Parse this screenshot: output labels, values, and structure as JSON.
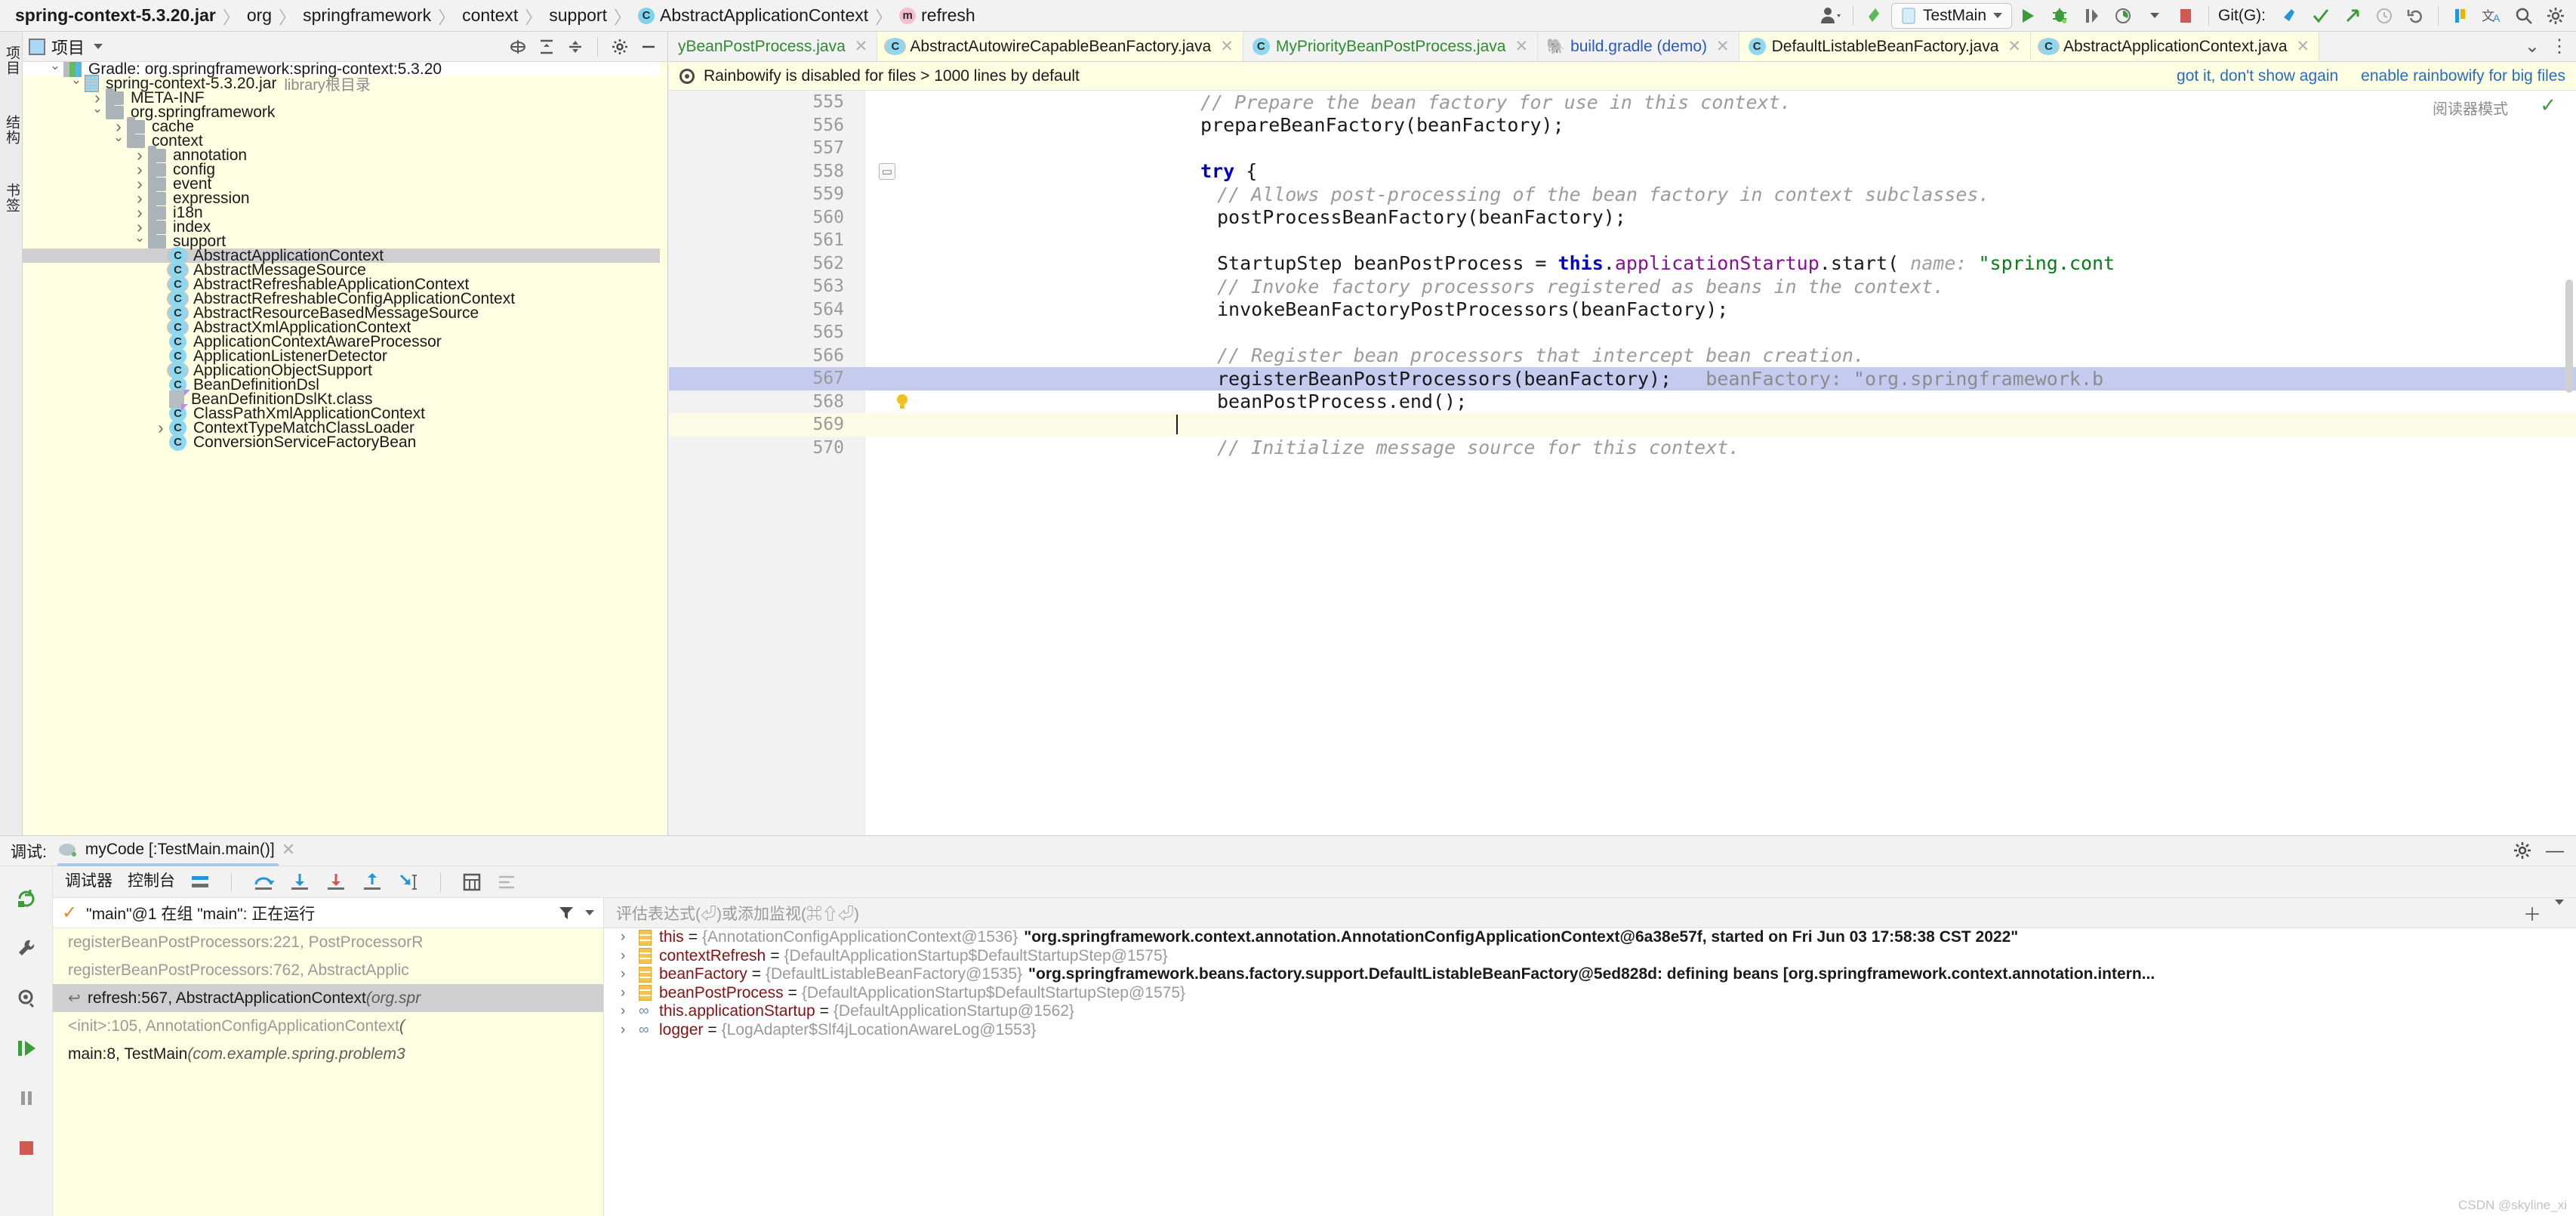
{
  "breadcrumb": {
    "items": [
      {
        "label": "spring-context-5.3.20.jar",
        "icon": "none",
        "bold": true
      },
      {
        "label": "org",
        "icon": "none",
        "bold": false
      },
      {
        "label": "springframework",
        "icon": "none",
        "bold": false
      },
      {
        "label": "context",
        "icon": "none",
        "bold": false
      },
      {
        "label": "support",
        "icon": "none",
        "bold": false
      },
      {
        "label": "AbstractApplicationContext",
        "icon": "class-icon",
        "bold": false
      },
      {
        "label": "refresh",
        "icon": "method-icon",
        "bold": false
      }
    ]
  },
  "toolbar": {
    "run_config": "TestMain",
    "git_label": "Git(G):",
    "icons": [
      "user-avatar-icon",
      "undo-arrow-icon",
      "run-icon",
      "debug-icon",
      "run-with-coverage-icon",
      "profile-icon",
      "stop-icon",
      "git-update-icon",
      "git-commit-icon",
      "git-push-icon",
      "git-history-icon",
      "git-rollback-icon",
      "bookmark-icon",
      "translate-icon",
      "search-icon",
      "settings-icon"
    ]
  },
  "left_strip": {
    "labels": [
      "项目",
      "结构",
      "书签"
    ]
  },
  "project_panel": {
    "title": "项目",
    "header_icons": [
      "locate-icon",
      "collapse-all-icon",
      "expand-icon",
      "gear-icon",
      "hide-icon"
    ],
    "tree": [
      {
        "depth": 1,
        "arrow": "down",
        "icon": "gradle-icon",
        "label": "Gradle: org.springframework:spring-context:5.3.20",
        "selected": false,
        "bg": "white"
      },
      {
        "depth": 2,
        "arrow": "down",
        "icon": "jar-icon",
        "label": "spring-context-5.3.20.jar",
        "note": "library根目录",
        "selected": false,
        "bg": "yellow"
      },
      {
        "depth": 3,
        "arrow": "right",
        "icon": "folder-icon",
        "label": "META-INF",
        "selected": false,
        "bg": "yellow"
      },
      {
        "depth": 3,
        "arrow": "down",
        "icon": "folder-icon",
        "label": "org.springframework",
        "selected": false,
        "bg": "yellow"
      },
      {
        "depth": 4,
        "arrow": "right",
        "icon": "folder-icon",
        "label": "cache",
        "selected": false,
        "bg": "yellow"
      },
      {
        "depth": 4,
        "arrow": "down",
        "icon": "folder-icon",
        "label": "context",
        "selected": false,
        "bg": "yellow"
      },
      {
        "depth": 5,
        "arrow": "right",
        "icon": "folder-icon",
        "label": "annotation",
        "selected": false,
        "bg": "yellow"
      },
      {
        "depth": 5,
        "arrow": "right",
        "icon": "folder-icon",
        "label": "config",
        "selected": false,
        "bg": "yellow"
      },
      {
        "depth": 5,
        "arrow": "right",
        "icon": "folder-icon",
        "label": "event",
        "selected": false,
        "bg": "yellow"
      },
      {
        "depth": 5,
        "arrow": "right",
        "icon": "folder-icon",
        "label": "expression",
        "selected": false,
        "bg": "yellow"
      },
      {
        "depth": 5,
        "arrow": "right",
        "icon": "folder-icon",
        "label": "i18n",
        "selected": false,
        "bg": "yellow"
      },
      {
        "depth": 5,
        "arrow": "right",
        "icon": "folder-icon",
        "label": "index",
        "selected": false,
        "bg": "yellow"
      },
      {
        "depth": 5,
        "arrow": "down",
        "icon": "folder-icon",
        "label": "support",
        "selected": false,
        "bg": "yellow"
      },
      {
        "depth": 6,
        "arrow": "none",
        "icon": "abstract-class-icon",
        "label": "AbstractApplicationContext",
        "selected": true,
        "bg": "yellow"
      },
      {
        "depth": 6,
        "arrow": "none",
        "icon": "abstract-class-icon",
        "label": "AbstractMessageSource",
        "selected": false,
        "bg": "yellow"
      },
      {
        "depth": 6,
        "arrow": "none",
        "icon": "abstract-class-icon",
        "label": "AbstractRefreshableApplicationContext",
        "selected": false,
        "bg": "yellow"
      },
      {
        "depth": 6,
        "arrow": "none",
        "icon": "abstract-class-icon",
        "label": "AbstractRefreshableConfigApplicationContext",
        "selected": false,
        "bg": "yellow"
      },
      {
        "depth": 6,
        "arrow": "none",
        "icon": "abstract-class-icon",
        "label": "AbstractResourceBasedMessageSource",
        "selected": false,
        "bg": "yellow"
      },
      {
        "depth": 6,
        "arrow": "none",
        "icon": "abstract-class-icon",
        "label": "AbstractXmlApplicationContext",
        "selected": false,
        "bg": "yellow"
      },
      {
        "depth": 6,
        "arrow": "none",
        "icon": "class-icon",
        "label": "ApplicationContextAwareProcessor",
        "selected": false,
        "bg": "yellow"
      },
      {
        "depth": 6,
        "arrow": "none",
        "icon": "class-icon",
        "label": "ApplicationListenerDetector",
        "selected": false,
        "bg": "yellow"
      },
      {
        "depth": 6,
        "arrow": "none",
        "icon": "abstract-class-icon",
        "label": "ApplicationObjectSupport",
        "selected": false,
        "bg": "yellow"
      },
      {
        "depth": 6,
        "arrow": "none",
        "icon": "kotlin-class-icon",
        "label": "BeanDefinitionDsl",
        "selected": false,
        "bg": "yellow"
      },
      {
        "depth": 6,
        "arrow": "none",
        "icon": "kotlin-file-icon",
        "label": "BeanDefinitionDslKt.class",
        "selected": false,
        "bg": "yellow"
      },
      {
        "depth": 6,
        "arrow": "none",
        "icon": "class-icon",
        "label": "ClassPathXmlApplicationContext",
        "selected": false,
        "bg": "yellow"
      },
      {
        "depth": 6,
        "arrow": "right",
        "icon": "class-icon",
        "label": "ContextTypeMatchClassLoader",
        "selected": false,
        "bg": "yellow"
      },
      {
        "depth": 6,
        "arrow": "none",
        "icon": "class-icon",
        "label": "ConversionServiceFactoryBean",
        "selected": false,
        "bg": "yellow"
      }
    ]
  },
  "editor": {
    "tabs": [
      {
        "label": "yBeanPostProcess.java",
        "icon": "none",
        "color": "green",
        "active": false,
        "truncated": true
      },
      {
        "label": "AbstractAutowireCapableBeanFactory.java",
        "icon": "abstract-class-icon",
        "color": "dark",
        "active": true
      },
      {
        "label": "MyPriorityBeanPostProcess.java",
        "icon": "class-icon",
        "color": "green",
        "active": false
      },
      {
        "label": "build.gradle (demo)",
        "icon": "gradle-icon",
        "color": "blue",
        "active": false
      },
      {
        "label": "DefaultListableBeanFactory.java",
        "icon": "class-icon",
        "color": "dark",
        "active": true
      },
      {
        "label": "AbstractApplicationContext.java",
        "icon": "abstract-class-icon",
        "color": "dark",
        "active": true
      }
    ],
    "notification": {
      "text": "Rainbowify is disabled for files > 1000 lines by default",
      "actions": [
        "got it, don't show again",
        "enable rainbowify for big files"
      ]
    },
    "reader_mode": "阅读器模式",
    "lines": [
      {
        "num": "555",
        "indent": 2,
        "segments": [
          {
            "t": "// Prepare the bean factory for use in this context.",
            "c": "cmt"
          }
        ]
      },
      {
        "num": "556",
        "indent": 2,
        "segments": [
          {
            "t": "prepareBeanFactory(beanFactory);",
            "c": ""
          }
        ]
      },
      {
        "num": "557",
        "indent": 0,
        "segments": []
      },
      {
        "num": "558",
        "indent": 2,
        "segments": [
          {
            "t": "try",
            "c": "kw"
          },
          {
            "t": " {",
            "c": ""
          }
        ],
        "fold": true
      },
      {
        "num": "559",
        "indent": 3,
        "segments": [
          {
            "t": "// Allows post-processing of the bean factory in context subclasses.",
            "c": "cmt"
          }
        ]
      },
      {
        "num": "560",
        "indent": 3,
        "segments": [
          {
            "t": "postProcessBeanFactory(beanFactory);",
            "c": ""
          }
        ]
      },
      {
        "num": "561",
        "indent": 0,
        "segments": []
      },
      {
        "num": "562",
        "indent": 3,
        "segments": [
          {
            "t": "StartupStep beanPostProcess = ",
            "c": ""
          },
          {
            "t": "this",
            "c": "kw"
          },
          {
            "t": ".",
            "c": ""
          },
          {
            "t": "applicationStartup",
            "c": "fld"
          },
          {
            "t": ".start(",
            "c": ""
          },
          {
            "t": " name:",
            "c": "hint"
          },
          {
            "t": " \"spring.cont",
            "c": "str"
          }
        ]
      },
      {
        "num": "563",
        "indent": 3,
        "segments": [
          {
            "t": "// Invoke factory processors registered as beans in the context.",
            "c": "cmt"
          }
        ]
      },
      {
        "num": "564",
        "indent": 3,
        "segments": [
          {
            "t": "invokeBeanFactoryPostProcessors(beanFactory);",
            "c": ""
          }
        ]
      },
      {
        "num": "565",
        "indent": 0,
        "segments": []
      },
      {
        "num": "566",
        "indent": 3,
        "segments": [
          {
            "t": "// Register bean processors that intercept bean creation.",
            "c": "cmt"
          }
        ]
      },
      {
        "num": "567",
        "indent": 3,
        "highlight": true,
        "segments": [
          {
            "t": "registerBeanPostProcessors(beanFactory);",
            "c": ""
          },
          {
            "t": "   beanFactory: ",
            "c": "hintbox"
          },
          {
            "t": "\"org.springframework.b",
            "c": "hintbox"
          }
        ]
      },
      {
        "num": "568",
        "indent": 3,
        "bulb": true,
        "segments": [
          {
            "t": "beanPostProcess.end();",
            "c": ""
          }
        ]
      },
      {
        "num": "569",
        "indent": 3,
        "caretline": true,
        "caret": true,
        "segments": []
      },
      {
        "num": "570",
        "indent": 3,
        "segments": [
          {
            "t": "// Initialize message source for this context.",
            "c": "cmt"
          }
        ]
      }
    ]
  },
  "debug": {
    "title_label": "调试:",
    "session_name": "myCode [:TestMain.main()]",
    "tabs": [
      {
        "label": "调试器",
        "active": true
      },
      {
        "label": "控制台",
        "active": false
      }
    ],
    "toolbar_icons": [
      "layout-icon",
      "step-over-icon",
      "step-into-icon",
      "force-step-into-icon",
      "step-out-icon",
      "run-to-cursor-icon",
      "evaluate-icon",
      "mute-breakpoints-icon"
    ],
    "rail_icons": [
      "rerun-icon",
      "settings-wrench-icon",
      "view-breakpoints-icon",
      "resume-icon",
      "pause-icon",
      "stop-icon"
    ],
    "thread_status": "\"main\"@1 在组 \"main\": 正在运行",
    "frames": [
      {
        "text": "registerBeanPostProcessors:221, PostProcessorR",
        "selected": false,
        "dim": true,
        "italic_from": -1
      },
      {
        "text": "registerBeanPostProcessors:762, AbstractApplic",
        "selected": false,
        "dim": true,
        "italic_from": -1
      },
      {
        "text": "refresh:567, AbstractApplicationContext ",
        "pkg": "(org.spr",
        "selected": true,
        "dim": false
      },
      {
        "text": "<init>:105, AnnotationConfigApplicationContext ",
        "pkg": "(",
        "selected": false,
        "dim": true
      },
      {
        "text": "main:8, TestMain ",
        "pkg": "(com.example.spring.problem3",
        "selected": false,
        "dim": false
      }
    ],
    "evaluate_placeholder": "评估表达式(⏎)或添加监视(⌘⇧⏎)",
    "variables": [
      {
        "icon": "field-icon",
        "name": "this",
        "type": "{AnnotationConfigApplicationContext@1536}",
        "value": "\"org.springframework.context.annotation.AnnotationConfigApplicationContext@6a38e57f, started on Fri Jun 03 17:58:38 CST 2022\"",
        "expandable": true
      },
      {
        "icon": "field-icon",
        "name": "contextRefresh",
        "type": "{DefaultApplicationStartup$DefaultStartupStep@1575}",
        "value": "",
        "expandable": true
      },
      {
        "icon": "field-icon",
        "name": "beanFactory",
        "type": "{DefaultListableBeanFactory@1535}",
        "value": "\"org.springframework.beans.factory.support.DefaultListableBeanFactory@5ed828d: defining beans [org.springframework.context.annotation.intern...",
        "expandable": true
      },
      {
        "icon": "field-icon",
        "name": "beanPostProcess",
        "type": "{DefaultApplicationStartup$DefaultStartupStep@1575}",
        "value": "",
        "expandable": true
      },
      {
        "icon": "chain-icon",
        "name": "this.applicationStartup",
        "type": "{DefaultApplicationStartup@1562}",
        "value": "",
        "expandable": true
      },
      {
        "icon": "chain-icon",
        "name": "logger",
        "type": "{LogAdapter$Slf4jLocationAwareLog@1553}",
        "value": "",
        "expandable": true
      }
    ],
    "watermark": "CSDN @skyline_xi"
  }
}
